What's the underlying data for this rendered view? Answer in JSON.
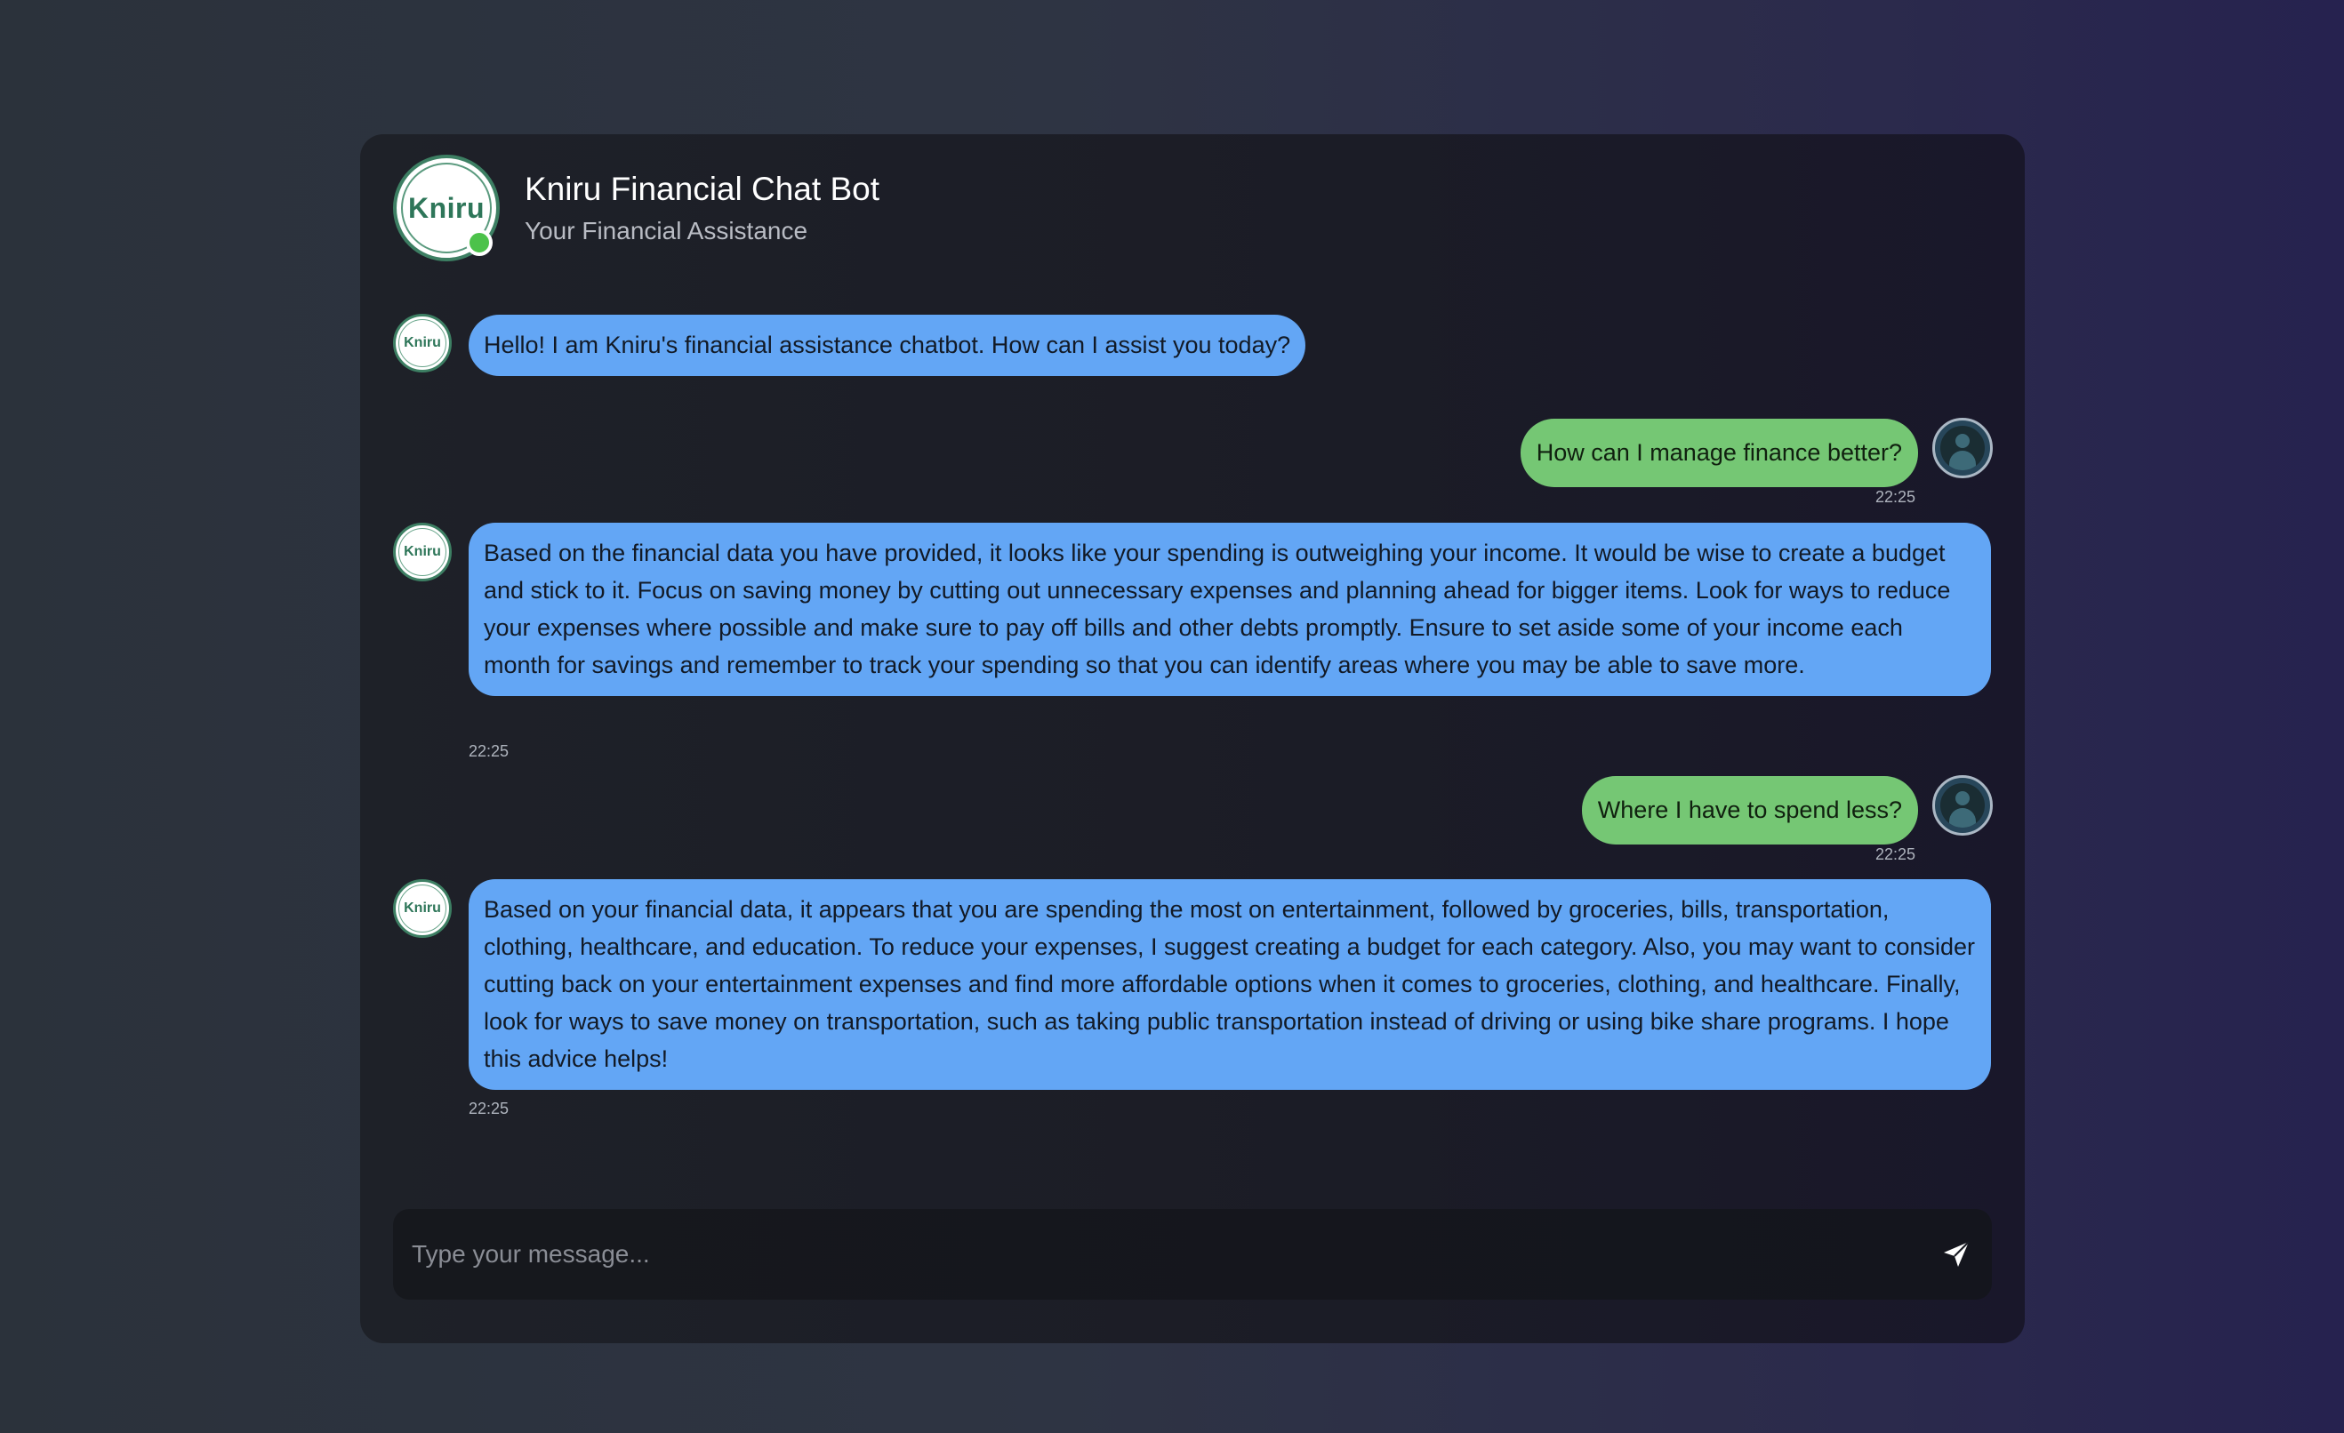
{
  "header": {
    "logo_text": "Kniru",
    "title": "Kniru Financial Chat Bot",
    "subtitle": "Your Financial Assistance",
    "status": "online"
  },
  "bot": {
    "avatar_text": "Kniru"
  },
  "messages": [
    {
      "sender": "bot",
      "text": "Hello! I am Kniru's financial assistance chatbot. How can I assist you today?",
      "time": ""
    },
    {
      "sender": "user",
      "text": "How can I manage finance better?",
      "time": "22:25"
    },
    {
      "sender": "bot",
      "text": "Based on the financial data you have provided, it looks like your spending is outweighing your income. It would be wise to create a budget and stick to it. Focus on saving money by cutting out unnecessary expenses and planning ahead for bigger items. Look for ways to reduce your expenses where possible and make sure to pay off bills and other debts promptly. Ensure to set aside some of your income each month for savings and remember to track your spending so that you can identify areas where you may be able to save more.",
      "time": "22:25"
    },
    {
      "sender": "user",
      "text": "Where I have to spend less?",
      "time": "22:25"
    },
    {
      "sender": "bot",
      "text": "Based on your financial data, it appears that you are spending the most on entertainment, followed by groceries, bills, transportation, clothing, healthcare, and education. To reduce your expenses, I suggest creating a budget for each category. Also, you may want to consider cutting back on your entertainment expenses and find more affordable options when it comes to groceries, clothing, and healthcare. Finally, look for ways to save money on transportation, such as taking public transportation instead of driving or using bike share programs. I hope this advice helps!",
      "time": "22:25"
    }
  ],
  "input": {
    "placeholder": "Type your message...",
    "value": ""
  },
  "icons": {
    "send": "send-arrow-icon",
    "user": "user-avatar-icon"
  },
  "colors": {
    "bot_bubble": "#63a6f5",
    "user_bubble": "#75c774",
    "brand": "#2e7659",
    "online": "#4cc24a"
  }
}
